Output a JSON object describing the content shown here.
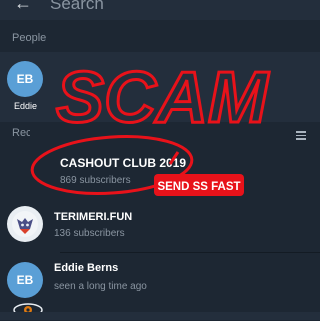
{
  "header": {
    "search_placeholder": "Search"
  },
  "people": {
    "section_label": "People",
    "items": [
      {
        "initials": "EB",
        "name": "Eddie"
      }
    ]
  },
  "recent": {
    "section_label": "Recent"
  },
  "results": [
    {
      "title": "CASHOUT CLUB 2019",
      "subtitle": "869 subscribers"
    },
    {
      "title": "TERIMERI.FUN",
      "subtitle": "136 subscribers"
    },
    {
      "title": "Eddie Berns",
      "subtitle": "seen a long time ago",
      "initials": "EB"
    }
  ],
  "annotation": {
    "scrawl": "SCAM",
    "badge": "SEND SS FAST"
  },
  "colors": {
    "accent": "#5a9fd6",
    "scrawl": "#e8121a",
    "background": "#1d2733"
  }
}
